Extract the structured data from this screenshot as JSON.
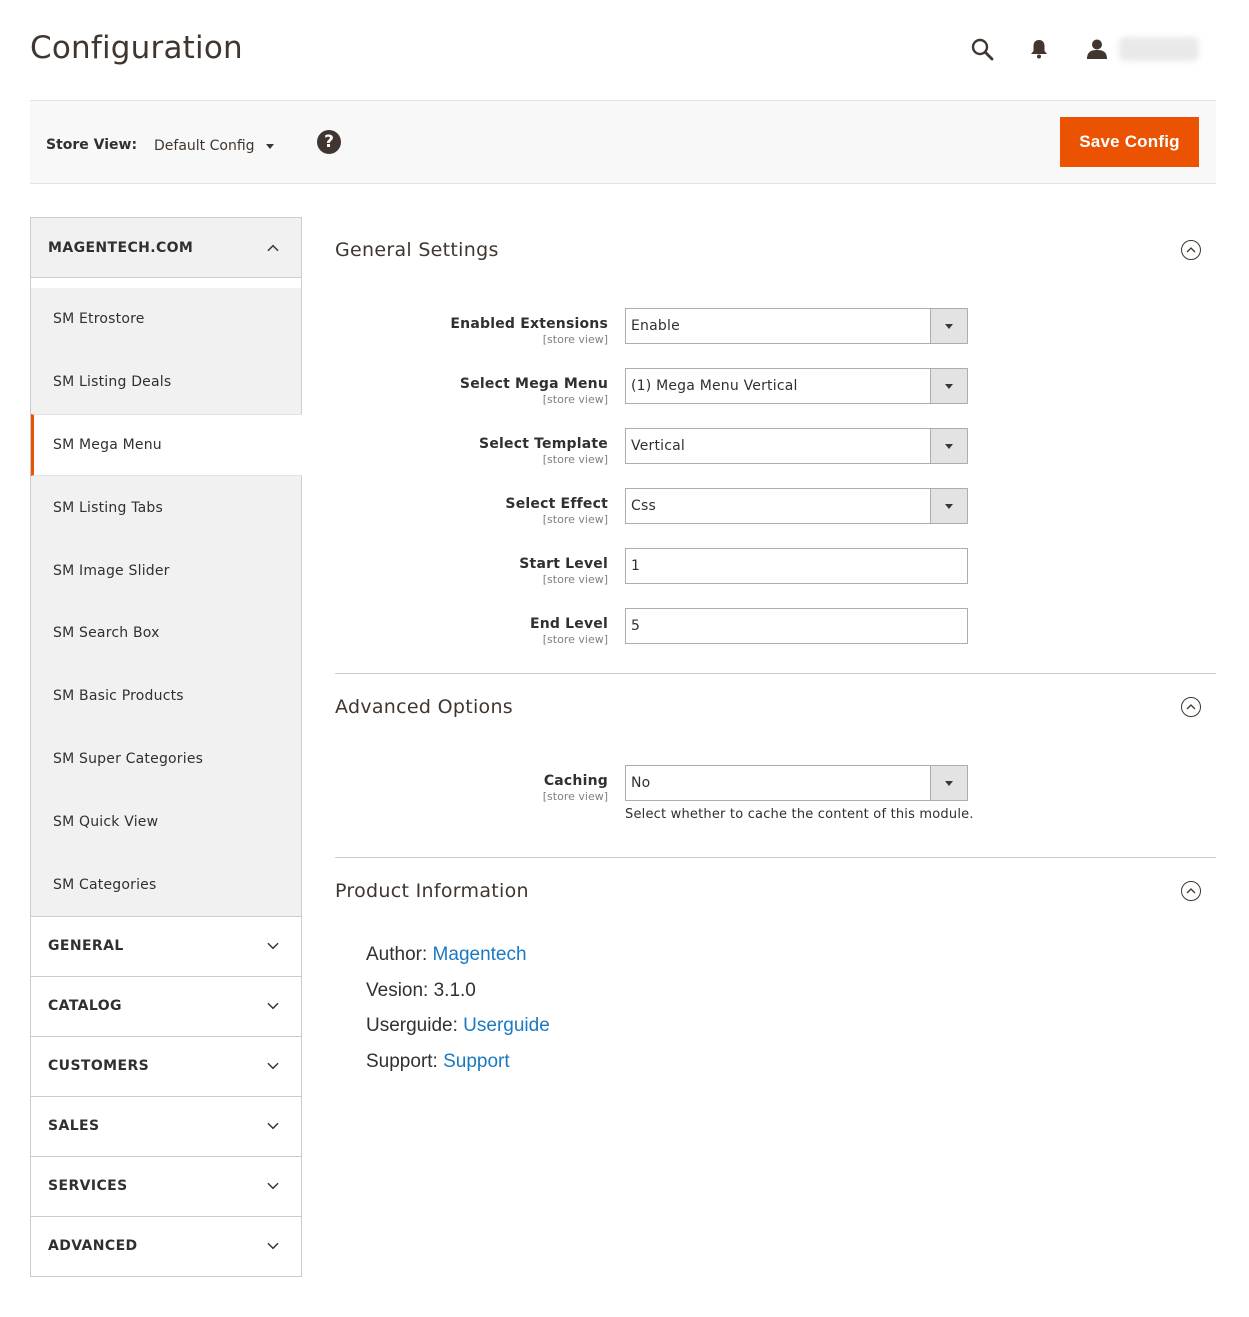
{
  "header": {
    "title": "Configuration"
  },
  "store_bar": {
    "label": "Store View:",
    "selected": "Default Config",
    "save_label": "Save Config",
    "help": "?"
  },
  "sidebar": {
    "open_section": {
      "title": "MAGENTECH.COM",
      "items": [
        "SM Etrostore",
        "SM Listing Deals",
        "SM Mega Menu",
        "SM Listing Tabs",
        "SM Image Slider",
        "SM Search Box",
        "SM Basic Products",
        "SM Super Categories",
        "SM Quick View",
        "SM Categories"
      ],
      "active_item": "SM Mega Menu"
    },
    "collapsed_sections": [
      "GENERAL",
      "CATALOG",
      "CUSTOMERS",
      "SALES",
      "SERVICES",
      "ADVANCED"
    ]
  },
  "general_settings": {
    "title": "General Settings",
    "fields": [
      {
        "label": "Enabled Extensions",
        "scope": "[store view]",
        "value": "Enable",
        "type": "select"
      },
      {
        "label": "Select Mega Menu",
        "scope": "[store view]",
        "value": "(1) Mega Menu Vertical",
        "type": "select"
      },
      {
        "label": "Select Template",
        "scope": "[store view]",
        "value": "Vertical",
        "type": "select"
      },
      {
        "label": "Select Effect",
        "scope": "[store view]",
        "value": "Css",
        "type": "select"
      },
      {
        "label": "Start Level",
        "scope": "[store view]",
        "value": "1",
        "type": "input"
      },
      {
        "label": "End Level",
        "scope": "[store view]",
        "value": "5",
        "type": "input"
      }
    ]
  },
  "advanced_options": {
    "title": "Advanced Options",
    "caching": {
      "label": "Caching",
      "scope": "[store view]",
      "value": "No",
      "note": "Select whether to cache the content of this module."
    }
  },
  "product_information": {
    "title": "Product Information",
    "author_label": "Author:",
    "author_link": "Magentech",
    "version_text": "Vesion: 3.1.0",
    "userguide_label": "Userguide:",
    "userguide_link": "Userguide",
    "support_label": "Support:",
    "support_link": "Support"
  },
  "colors": {
    "accent": "#eb5202",
    "link": "#1979c3"
  }
}
